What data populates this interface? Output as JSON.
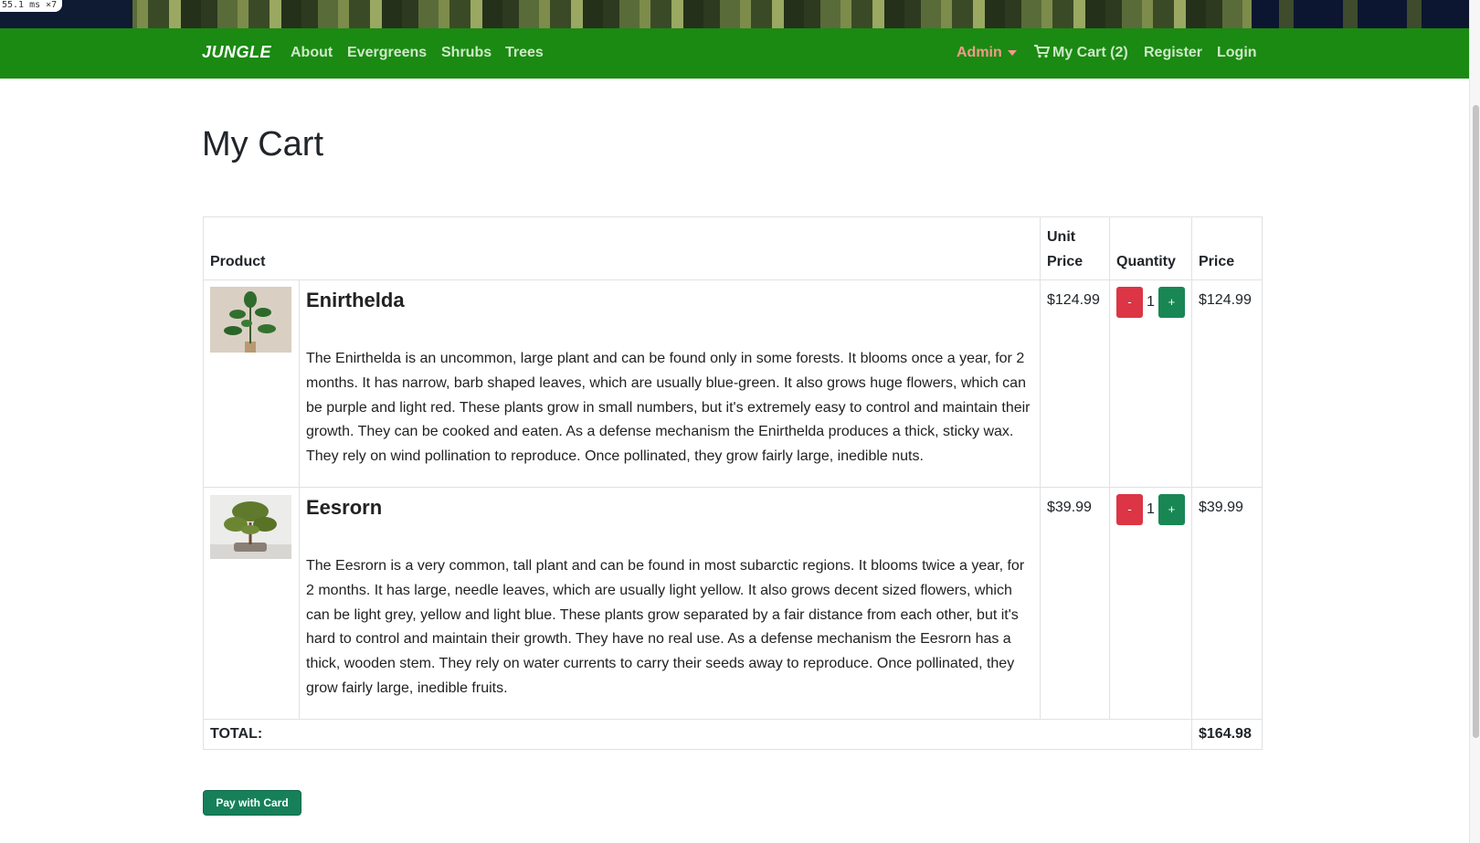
{
  "perf_badge": "55.1 ms ×7",
  "nav": {
    "brand": "JUNGLE",
    "links": [
      "About",
      "Evergreens",
      "Shrubs",
      "Trees"
    ],
    "admin": "Admin",
    "cart": "My Cart (2)",
    "register": "Register",
    "login": "Login"
  },
  "page": {
    "title": "My Cart"
  },
  "table": {
    "headers": {
      "product": "Product",
      "unit_price": "Unit Price",
      "quantity": "Quantity",
      "price": "Price"
    },
    "rows": [
      {
        "name": "Enirthelda",
        "description": "The Enirthelda is an uncommon, large plant and can be found only in some forests. It blooms once a year, for 2 months. It has narrow, barb shaped leaves, which are usually blue-green. It also grows huge flowers, which can be purple and light red. These plants grow in small numbers, but it's extremely easy to control and maintain their growth. They can be cooked and eaten. As a defense mechanism the Enirthelda produces a thick, sticky wax. They rely on wind pollination to reproduce. Once pollinated, they grow fairly large, inedible nuts.",
        "unit_price": "$124.99",
        "quantity": "1",
        "price": "$124.99",
        "minus": "-",
        "plus": "+"
      },
      {
        "name": "Eesrorn",
        "description": "The Eesrorn is a very common, tall plant and can be found in most subarctic regions. It blooms twice a year, for 2 months. It has large, needle leaves, which are usually light yellow. It also grows decent sized flowers, which can be light grey, yellow and light blue. These plants grow separated by a fair distance from each other, but it's hard to control and maintain their growth. They have no real use. As a defense mechanism the Eesrorn has a thick, wooden stem. They rely on water currents to carry their seeds away to reproduce. Once pollinated, they grow fairly large, inedible fruits.",
        "unit_price": "$39.99",
        "quantity": "1",
        "price": "$39.99",
        "minus": "-",
        "plus": "+"
      }
    ],
    "total_label": "TOTAL:",
    "total_value": "$164.98"
  },
  "pay_button": "Pay with Card",
  "colors": {
    "navbar": "#1a8a12",
    "minus": "#dc3545",
    "plus": "#198754",
    "admin": "#f59a8a"
  }
}
